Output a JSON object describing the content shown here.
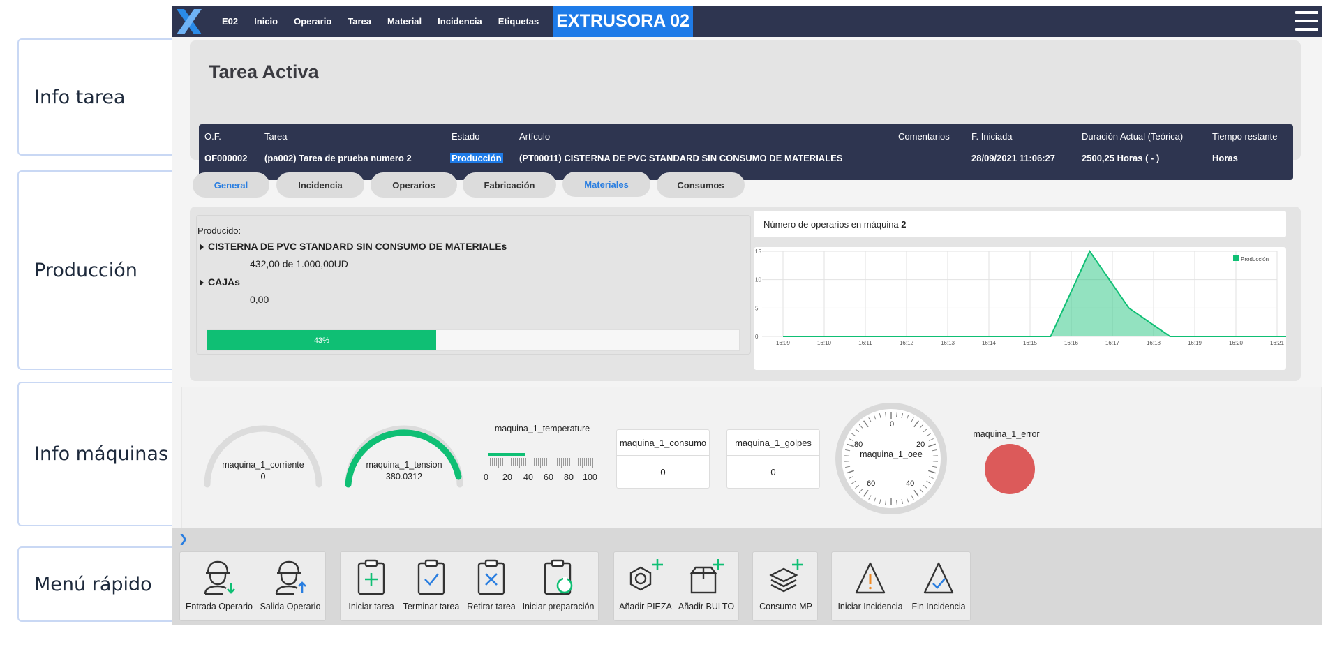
{
  "side_labels": {
    "info_tarea": "Info tarea",
    "produccion": "Producción",
    "info_maquinas": "Info máquinas",
    "menu_rapido": "Menú rápido"
  },
  "topbar": {
    "nav": [
      "E02",
      "Inicio",
      "Operario",
      "Tarea",
      "Material",
      "Incidencia",
      "Etiquetas"
    ],
    "machine_title": "EXTRUSORA 02"
  },
  "task": {
    "title": "Tarea Activa",
    "headers": {
      "of": "O.F.",
      "tarea": "Tarea",
      "estado": "Estado",
      "articulo": "Artículo",
      "comentarios": "Comentarios",
      "f_iniciada": "F. Iniciada",
      "duracion": "Duración Actual (Teórica)",
      "tiempo_restante": "Tiempo restante"
    },
    "row": {
      "of": "OF000002",
      "tarea": "(pa002) Tarea de prueba numero 2",
      "estado": "Producción",
      "articulo": "(PT00011) CISTERNA DE PVC STANDARD SIN CONSUMO DE MATERIALES",
      "comentarios": "",
      "f_iniciada": "28/09/2021 11:06:27",
      "duracion": "2500,25 Horas ( - )",
      "tiempo_restante": "Horas"
    }
  },
  "tabs": [
    "General",
    "Incidencia",
    "Operarios",
    "Fabricación",
    "Materiales",
    "Consumos"
  ],
  "production": {
    "producido_label": "Producido:",
    "item1_name": "CISTERNA DE PVC STANDARD SIN CONSUMO DE MATERIALEs",
    "item1_qty": "432,00 de 1.000,00UD",
    "item2_name": "CAJAs",
    "item2_qty": "0,00",
    "progress_text": "43%",
    "progress_value": 43,
    "operators_label": "Número de operarios en máquina",
    "operators_count": "2"
  },
  "chart_data": {
    "type": "area",
    "x": [
      "16:09",
      "16:10",
      "16:11",
      "16:12",
      "16:13",
      "16:14",
      "16:15",
      "16:16",
      "16:17",
      "16:18",
      "16:19",
      "16:20",
      "16:21"
    ],
    "series": [
      {
        "name": "Producción",
        "points": [
          [
            0,
            0
          ],
          [
            6.5,
            0
          ],
          [
            7.45,
            15
          ],
          [
            8.4,
            5
          ],
          [
            9.4,
            0
          ],
          [
            12.4,
            0
          ]
        ]
      }
    ],
    "ylim": [
      0,
      15
    ],
    "yticks": [
      "0",
      "5",
      "10",
      "15"
    ],
    "legend": "top-right",
    "color": "#0fbf74",
    "grid": true
  },
  "machines": {
    "corriente": {
      "label": "maquina_1_corriente",
      "value": "0"
    },
    "tension": {
      "label": "maquina_1_tension",
      "value": "380.0312"
    },
    "temperature": {
      "label": "maquina_1_temperature",
      "ticks": [
        "0",
        "20",
        "40",
        "60",
        "80",
        "100"
      ]
    },
    "consumo": {
      "label": "maquina_1_consumo",
      "value": "0"
    },
    "golpes": {
      "label": "maquina_1_golpes",
      "value": "0"
    },
    "oee": {
      "label": "maquina_1_oee",
      "ticks": [
        "0",
        "20",
        "40",
        "60",
        "80"
      ]
    },
    "error": {
      "label": "maquina_1_error",
      "color": "#dc5a5a"
    }
  },
  "quick_menu": {
    "entrada_operario": "Entrada Operario",
    "salida_operario": "Salida Operario",
    "iniciar_tarea": "Iniciar tarea",
    "terminar_tarea": "Terminar tarea",
    "retirar_tarea": "Retirar tarea",
    "iniciar_preparacion": "Iniciar preparación",
    "anadir_pieza": "Añadir PIEZA",
    "anadir_bulto": "Añadir BULTO",
    "consumo_mp": "Consumo MP",
    "iniciar_incidencia": "Iniciar Incidencia",
    "fin_incidencia": "Fin Incidencia"
  },
  "colors": {
    "accent": "#1e7be8",
    "navy": "#2e3550",
    "green": "#0fbf74",
    "error": "#dc5a5a"
  }
}
